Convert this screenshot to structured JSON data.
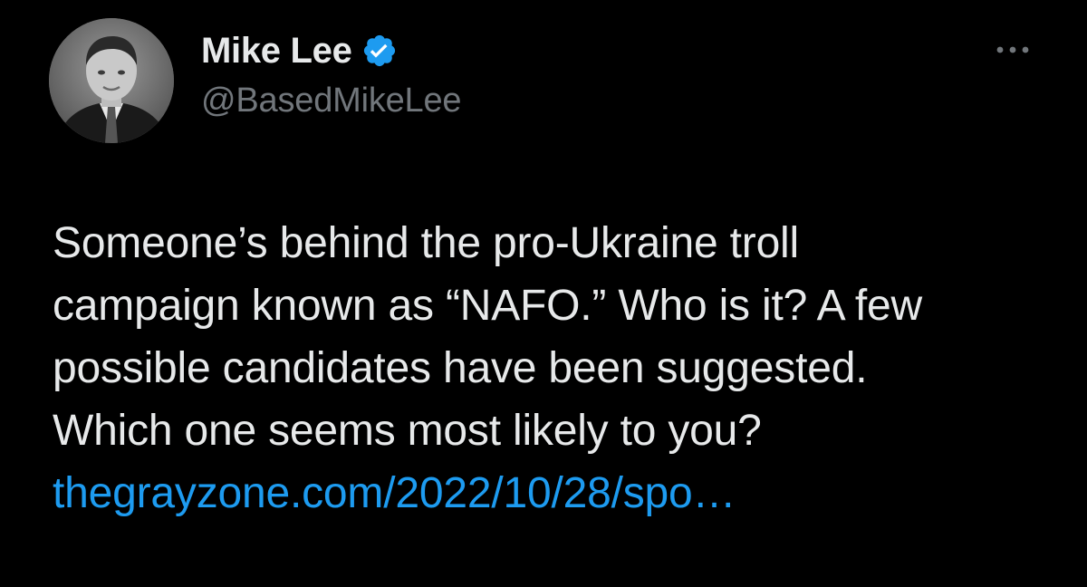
{
  "author": {
    "display_name": "Mike Lee",
    "handle": "@BasedMikeLee",
    "verified": true,
    "avatar_icon": "profile-photo"
  },
  "tweet": {
    "text_lines": [
      "Someone’s behind the pro-Ukraine troll",
      "campaign known as “NAFO.” Who is it? A few",
      "possible candidates have been suggested.",
      "Which one seems most likely to you?"
    ],
    "link": "thegrayzone.com/2022/10/28/spo…"
  },
  "icons": {
    "verified": "verified-badge-icon",
    "more": "more-options-icon"
  },
  "colors": {
    "background": "#000000",
    "text_primary": "#e7e9ea",
    "text_secondary": "#71767b",
    "link": "#1d9bf0",
    "verified": "#1d9bf0"
  }
}
